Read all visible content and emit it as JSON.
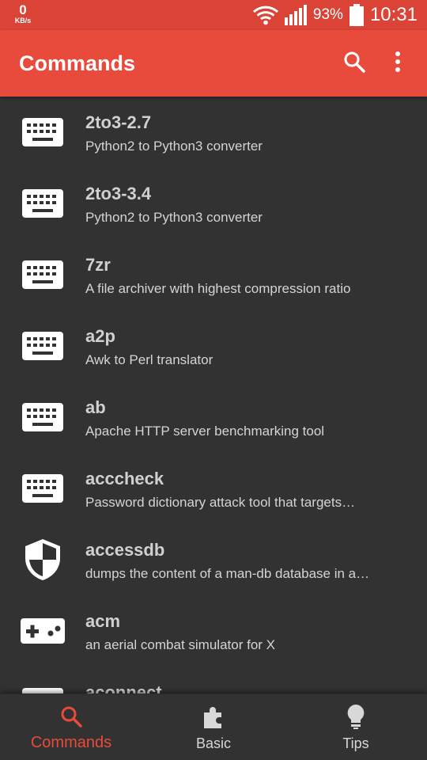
{
  "status_bar": {
    "net_speed_value": "0",
    "net_speed_unit": "KB/s",
    "battery_percent": "93%",
    "time": "10:31",
    "icons": [
      "wifi-icon",
      "signal-icon",
      "battery-icon"
    ]
  },
  "app_bar": {
    "title": "Commands",
    "background": "#e84b3c",
    "actions": [
      "search-icon",
      "more-vert-icon"
    ]
  },
  "commands": [
    {
      "name": "2to3-2.7",
      "description": "Python2 to Python3 converter",
      "icon": "keyboard-icon"
    },
    {
      "name": "2to3-3.4",
      "description": "Python2 to Python3 converter",
      "icon": "keyboard-icon"
    },
    {
      "name": "7zr",
      "description": "A file archiver with highest compression ratio",
      "icon": "keyboard-icon"
    },
    {
      "name": "a2p",
      "description": "Awk to Perl translator",
      "icon": "keyboard-icon"
    },
    {
      "name": "ab",
      "description": "Apache HTTP server benchmarking tool",
      "icon": "keyboard-icon"
    },
    {
      "name": "acccheck",
      "description": "Password dictionary attack tool that targets…",
      "icon": "keyboard-icon"
    },
    {
      "name": "accessdb",
      "description": "dumps the content of a man-db database in a…",
      "icon": "security-shield-icon"
    },
    {
      "name": "acm",
      "description": "an aerial combat simulator for X",
      "icon": "gamepad-icon"
    },
    {
      "name": "aconnect",
      "description": "",
      "icon": "keyboard-icon"
    }
  ],
  "bottom_nav": {
    "tabs": [
      {
        "label": "Commands",
        "icon": "search-icon",
        "active": true
      },
      {
        "label": "Basic",
        "icon": "puzzle-icon",
        "active": false
      },
      {
        "label": "Tips",
        "icon": "lightbulb-icon",
        "active": false
      }
    ],
    "active_color": "#e84b3c"
  }
}
